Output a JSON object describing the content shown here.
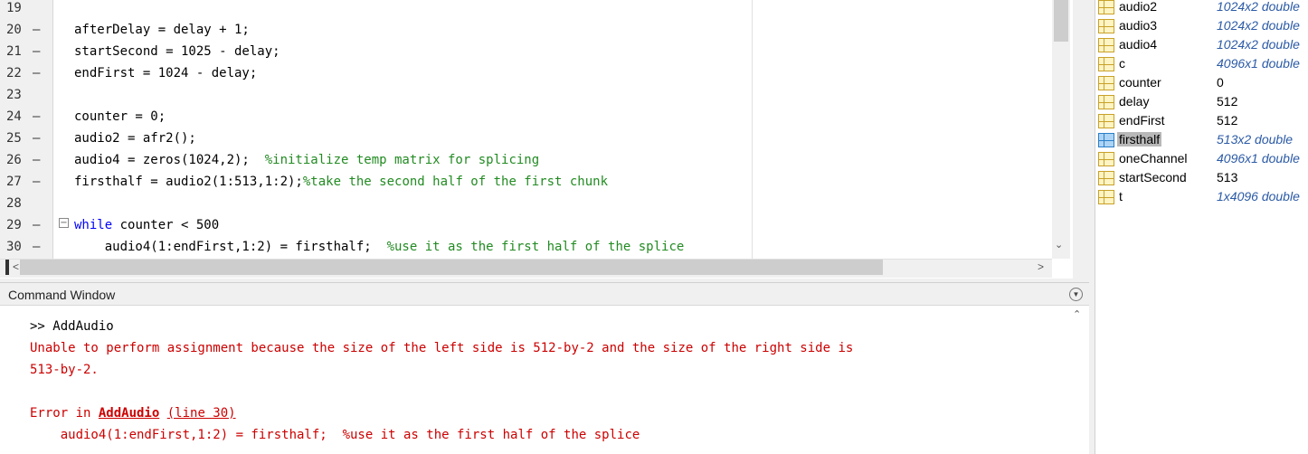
{
  "editor": {
    "lines": [
      {
        "num": "19",
        "dash": "",
        "code": ""
      },
      {
        "num": "20",
        "dash": "–",
        "code": "afterDelay = delay + 1;"
      },
      {
        "num": "21",
        "dash": "–",
        "code": "startSecond = 1025 - delay;"
      },
      {
        "num": "22",
        "dash": "–",
        "code": "endFirst = 1024 - delay;"
      },
      {
        "num": "23",
        "dash": "",
        "code": ""
      },
      {
        "num": "24",
        "dash": "–",
        "code": "counter = 0;"
      },
      {
        "num": "25",
        "dash": "–",
        "code": "audio2 = afr2();"
      },
      {
        "num": "26",
        "dash": "–",
        "code": "audio4 = zeros(1024,2);  ",
        "comment": "%initialize temp matrix for splicing"
      },
      {
        "num": "27",
        "dash": "–",
        "code": "firsthalf = audio2(1:513,1:2);",
        "comment": "%take the second half of the first chunk"
      },
      {
        "num": "28",
        "dash": "",
        "code": ""
      },
      {
        "num": "29",
        "dash": "–",
        "keyword": "while",
        "code": " counter < 500"
      },
      {
        "num": "30",
        "dash": "–",
        "code": "    audio4(1:endFirst,1:2) = firsthalf;  ",
        "comment": "%use it as the first half of the splice"
      }
    ]
  },
  "workspace": {
    "vars": [
      {
        "name": "audio2",
        "value": "1024x2 double",
        "italic": true
      },
      {
        "name": "audio3",
        "value": "1024x2 double",
        "italic": true
      },
      {
        "name": "audio4",
        "value": "1024x2 double",
        "italic": true
      },
      {
        "name": "c",
        "value": "4096x1 double",
        "italic": true
      },
      {
        "name": "counter",
        "value": "0",
        "italic": false
      },
      {
        "name": "delay",
        "value": "512",
        "italic": false
      },
      {
        "name": "endFirst",
        "value": "512",
        "italic": false
      },
      {
        "name": "firsthalf",
        "value": "513x2 double",
        "italic": true,
        "selected": true
      },
      {
        "name": "oneChannel",
        "value": "4096x1 double",
        "italic": true
      },
      {
        "name": "startSecond",
        "value": "513",
        "italic": false
      },
      {
        "name": "t",
        "value": "1x4096 double",
        "italic": true
      }
    ]
  },
  "command_window": {
    "title": "Command Window",
    "prompt": ">> AddAudio",
    "error1": "Unable to perform assignment because the size of the left side is 512-by-2 and the size of the right side is",
    "error2": "513-by-2.",
    "error_in": "Error in ",
    "error_func": "AddAudio",
    "error_line": "(line 30)",
    "error_code": "    audio4(1:endFirst,1:2) = firsthalf;  %use it as the first half of the splice"
  },
  "colors": {
    "error": "#cc0000",
    "comment": "#228b22",
    "keyword": "#0000ff"
  }
}
